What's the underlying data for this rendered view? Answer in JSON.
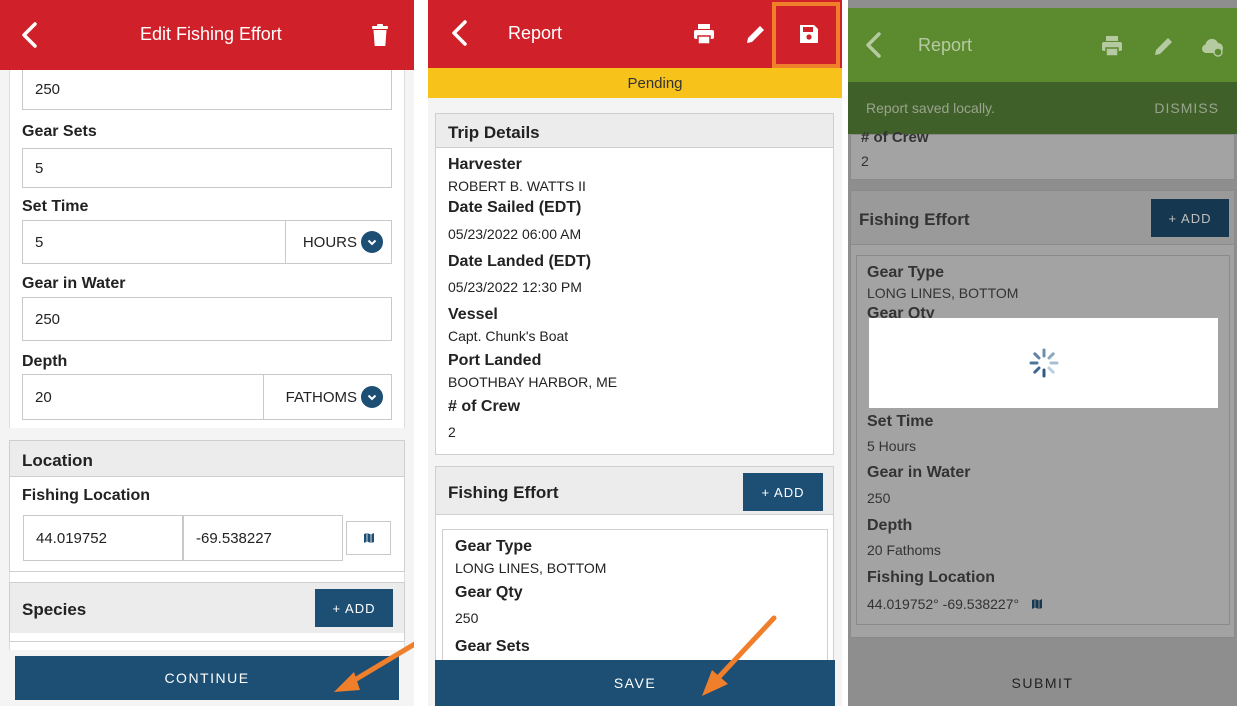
{
  "panel1": {
    "title": "Edit Fishing Effort",
    "gear_qty_value": "250",
    "gear_sets_label": "Gear Sets",
    "gear_sets_value": "5",
    "set_time_label": "Set Time",
    "set_time_value": "5",
    "set_time_unit": "HOURS",
    "gear_in_water_label": "Gear in Water",
    "gear_in_water_value": "250",
    "depth_label": "Depth",
    "depth_value": "20",
    "depth_unit": "FATHOMS",
    "location_section": "Location",
    "fishing_location_label": "Fishing Location",
    "latitude": "44.019752",
    "longitude": "-69.538227",
    "species_section": "Species",
    "add_label": "+ ADD",
    "continue_label": "CONTINUE"
  },
  "panel2": {
    "title": "Report",
    "status": "Pending",
    "trip_details_section": "Trip Details",
    "harvester_label": "Harvester",
    "harvester_value": "ROBERT B. WATTS II",
    "date_sailed_label": "Date Sailed (EDT)",
    "date_sailed_value": "05/23/2022 06:00 AM",
    "date_landed_label": "Date Landed (EDT)",
    "date_landed_value": "05/23/2022 12:30 PM",
    "vessel_label": "Vessel",
    "vessel_value": "Capt. Chunk's Boat",
    "port_landed_label": "Port Landed",
    "port_landed_value": "BOOTHBAY HARBOR, ME",
    "crew_label": "# of Crew",
    "crew_value": "2",
    "fishing_effort_section": "Fishing Effort",
    "add_label": "+ ADD",
    "gear_type_label": "Gear Type",
    "gear_type_value": "LONG LINES, BOTTOM",
    "gear_qty_label": "Gear Qty",
    "gear_qty_value": "250",
    "gear_sets_label": "Gear Sets",
    "save_label": "SAVE"
  },
  "panel3": {
    "title": "Report",
    "snackbar_text": "Report saved locally.",
    "dismiss_label": "DISMISS",
    "crew_label": "# of Crew",
    "crew_value": "2",
    "fishing_effort_section": "Fishing Effort",
    "add_label": "+ ADD",
    "gear_type_label": "Gear Type",
    "gear_type_value": "LONG LINES, BOTTOM",
    "gear_qty_label": "Gear Qty",
    "set_time_label": "Set Time",
    "set_time_value": "5 Hours",
    "gear_in_water_label": "Gear in Water",
    "gear_in_water_value": "250",
    "depth_label": "Depth",
    "depth_value": "20 Fathoms",
    "fishing_location_label": "Fishing Location",
    "fishing_location_value": "44.019752° -69.538227°",
    "submit_label": "SUBMIT"
  },
  "colors": {
    "appbar_red": "#d0202a",
    "appbar_green": "#5c8a2f",
    "pending_yellow": "#f7c31a",
    "primary_blue": "#1d4e74",
    "annotation_orange": "#f07f2c"
  },
  "icons": [
    "back-chevron-icon",
    "trash-icon",
    "print-icon",
    "edit-pencil-icon",
    "save-disk-icon",
    "cloud-upload-icon",
    "map-icon",
    "chevron-down-icon",
    "loading-spinner-icon"
  ]
}
